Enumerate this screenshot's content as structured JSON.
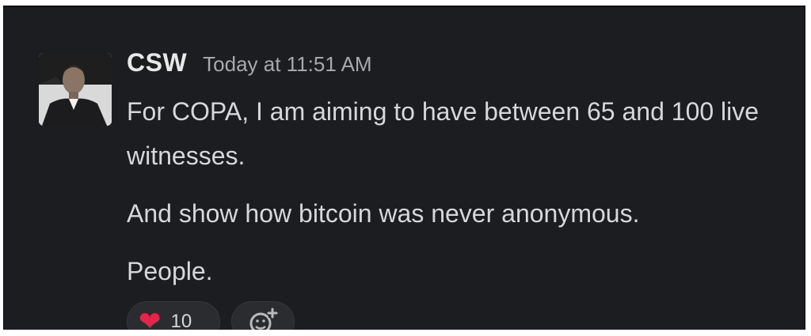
{
  "message": {
    "author": "CSW",
    "timestamp": "Today at 11:51 AM",
    "paragraphs": [
      "For COPA, I am aiming to have between 65 and 100 live witnesses.",
      "And show how bitcoin was never anonymous.",
      "People."
    ],
    "reactions": [
      {
        "emoji": "heart-icon",
        "count": "10"
      }
    ]
  },
  "colors": {
    "background": "#1b1d21",
    "author": "#e8e8e8",
    "timestamp": "#a7a9ac",
    "text": "#d6d7d9",
    "heart": "#e4254b"
  }
}
